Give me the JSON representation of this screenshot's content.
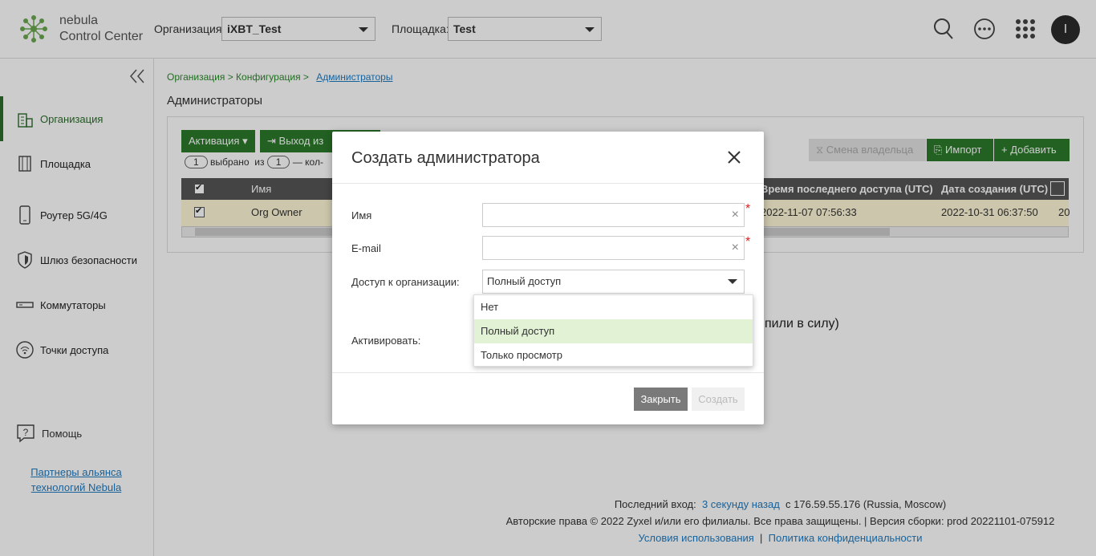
{
  "header": {
    "brand_line1": "nebula",
    "brand_line2": "Control Center",
    "org_label": "Организация:",
    "org_value": "iXBT_Test",
    "site_label": "Площадка:",
    "site_value": "Test",
    "avatar_letter": "I",
    "icons": [
      "search-icon",
      "more-icon",
      "apps-grid-icon"
    ]
  },
  "sidebar": {
    "items": [
      {
        "label": "Организация",
        "icon": "building-icon",
        "active": true
      },
      {
        "label": "Площадка",
        "icon": "site-icon",
        "active": false
      },
      {
        "label": "Роутер 5G/4G",
        "icon": "phone-icon",
        "active": false
      },
      {
        "label": "Шлюз безопасности",
        "icon": "shield-icon",
        "active": false
      },
      {
        "label": "Коммутаторы",
        "icon": "switch-icon",
        "active": false
      },
      {
        "label": "Точки доступа",
        "icon": "wifi-icon",
        "active": false
      }
    ],
    "help_label": "Помощь",
    "partners_line1": "Партнеры альянса",
    "partners_line2": "технологий Nebula"
  },
  "main": {
    "breadcrumb": {
      "part1": "Организация > Конфигурация >",
      "current": "Администраторы"
    },
    "title": "Администраторы",
    "toolbar": {
      "activation": "Активация",
      "exit": "Выход из",
      "change_owner": "Смена владельца",
      "import": "Импорт",
      "add": "Добавить"
    },
    "selection": {
      "count": "1",
      "selected": "выбрано",
      "of": "из",
      "total": "1",
      "tail": "— кол-"
    },
    "table": {
      "columns": [
        "Имя",
        "Время последнего доступа (UTC)",
        "Дата создания (UTC)"
      ],
      "rows": [
        {
          "name": "Org Owner",
          "last_access": "2022-11-07 07:56:33",
          "created": "2022-10-31 06:37:50",
          "extra": "20"
        }
      ]
    },
    "partial_notice": "пили в силу)"
  },
  "footer": {
    "last_login_label": "Последний вход:",
    "last_login_link": "3 секунду назад",
    "last_login_ip": "с 176.59.55.176 (Russia, Moscow)",
    "copyright": "Авторские права © 2022 Zyxel и/или его филиалы. Все права защищены. | Версия сборки: prod 20221101-075912",
    "terms": "Условия использования",
    "separator": "|",
    "privacy": "Политика конфиденциальности"
  },
  "modal": {
    "title": "Создать администратора",
    "name_label": "Имя",
    "name_value": "",
    "email_label": "E-mail",
    "email_value": "",
    "access_label": "Доступ к организации:",
    "access_value": "Полный доступ",
    "activate_label": "Активировать:",
    "options": [
      "Нет",
      "Полный доступ",
      "Только просмотр"
    ],
    "close_btn": "Закрыть",
    "create_btn": "Создать"
  },
  "colors": {
    "brand_green": "#2b7a2b",
    "link_blue": "#1f7bc1",
    "selected_option": "#e2f2d5"
  }
}
